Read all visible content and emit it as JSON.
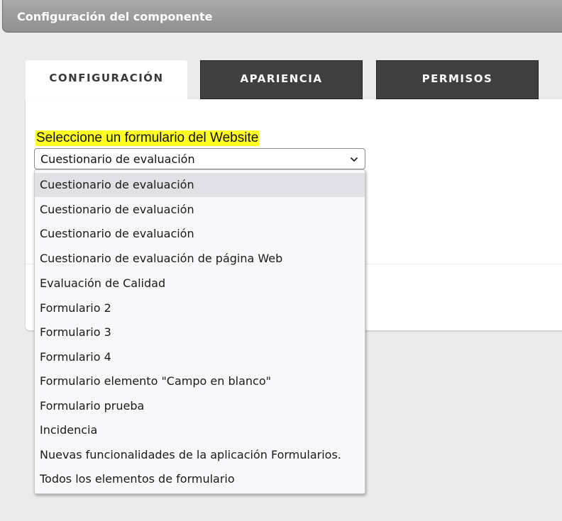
{
  "header": {
    "title": "Configuración del componente"
  },
  "tabs": [
    {
      "label": "CONFIGURACIÓN",
      "active": true
    },
    {
      "label": "APARIENCIA",
      "active": false
    },
    {
      "label": "PERMISOS",
      "active": false
    }
  ],
  "form": {
    "label": "Seleccione un formulario del Website",
    "selected": "Cuestionario de evaluación",
    "chevron_icon": "chevron-down-icon"
  },
  "dropdown": {
    "options": [
      "Cuestionario de evaluación",
      "Cuestionario de evaluación",
      "Cuestionario de evaluación",
      "Cuestionario de evaluación de página Web",
      "Evaluación de Calidad",
      "Formulario 2",
      "Formulario 3",
      "Formulario 4",
      "Formulario elemento \"Campo en blanco\"",
      "Formulario prueba",
      "Incidencia",
      "Nuevas funcionalidades de la aplicación Formularios.",
      "Todos los elementos de formulario"
    ],
    "highlighted_index": 0
  },
  "colors": {
    "label_highlight": "#ffff22",
    "tab_inactive_bg": "#404040",
    "header_bg": "#9d9d9d"
  }
}
